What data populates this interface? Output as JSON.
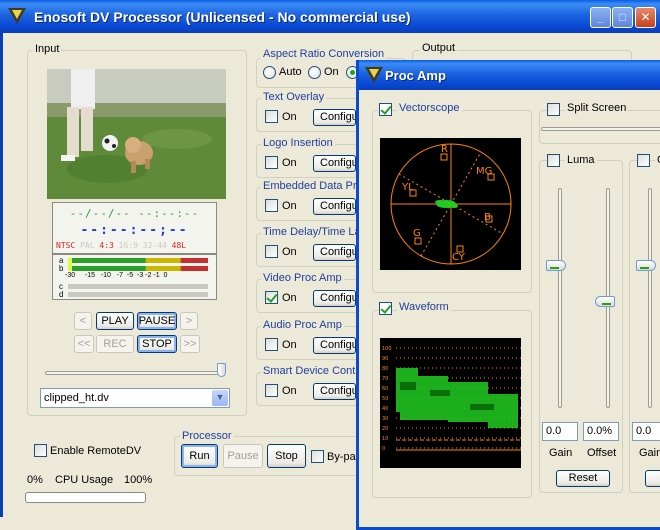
{
  "window": {
    "title": "Enosoft DV Processor (Unlicensed - No commercial use)",
    "minimize": "_",
    "maximize": "□",
    "close": "✕"
  },
  "input": {
    "label": "Input",
    "timecode_line1": "--/--/-- --:--:--",
    "timecode_line2": "--:--:--;--",
    "status_items": [
      "NTSC",
      "PAL",
      "4:3",
      "16:9",
      "32-44",
      "48L"
    ],
    "meter_rows": [
      "a",
      "b",
      "c",
      "d"
    ],
    "meter_scale": [
      "-30",
      "-15",
      "-10",
      "-7",
      "-5",
      "-3",
      "-2",
      "-1",
      "0"
    ],
    "buttons": {
      "prev": "<",
      "play": "PLAY",
      "pause": "PAUSE",
      "next": ">",
      "rewind": "<<",
      "rec": "REC",
      "stop": "STOP",
      "ffwd": ">>"
    },
    "file_select": "clipped_ht.dv"
  },
  "enable_remote": "Enable RemoteDV",
  "cpu": {
    "low": "0%",
    "label": "CPU Usage",
    "high": "100%",
    "usage": 0
  },
  "processor": {
    "label": "Processor",
    "run": "Run",
    "pause": "Pause",
    "stop": "Stop",
    "bypass": "By-pa"
  },
  "sections": [
    {
      "title": "Aspect Ratio Conversion"
    },
    {
      "title": "Text Overlay",
      "check": "On",
      "checked": false,
      "button": "Configu"
    },
    {
      "title": "Logo Insertion",
      "check": "On",
      "checked": false,
      "button": "Configu"
    },
    {
      "title": "Embedded Data Pro",
      "check": "On",
      "checked": false,
      "button": "Configu"
    },
    {
      "title": "Time Delay/Time La",
      "check": "On",
      "checked": false,
      "button": "Configu"
    },
    {
      "title": "Video Proc Amp",
      "check": "On",
      "checked": true,
      "button": "Configu"
    },
    {
      "title": "Audio Proc Amp",
      "check": "On",
      "checked": false,
      "button": "Configu"
    },
    {
      "title": "Smart Device Contr",
      "check": "On",
      "checked": false,
      "button": "Configu"
    }
  ],
  "aspect_radios": {
    "auto": "Auto",
    "on": "On",
    "selected": "third"
  },
  "output": {
    "label": "Output"
  },
  "proc_amp": {
    "title": "Proc Amp",
    "vectorscope": {
      "label": "Vectorscope",
      "checked": true,
      "targets": [
        "R",
        "MG",
        "YL",
        "B",
        "G",
        "CY"
      ]
    },
    "waveform": {
      "label": "Waveform",
      "checked": true,
      "scale": [
        "100",
        "90",
        "80",
        "70",
        "60",
        "50",
        "40",
        "30",
        "20",
        "10",
        "0"
      ]
    },
    "split_screen": {
      "label": "Split Screen",
      "checked": false
    },
    "luma": {
      "label": "Luma",
      "checked": false,
      "gain_value": "0.0",
      "offset_value": "0.0%",
      "gain_label": "Gain",
      "offset_label": "Offset",
      "reset": "Reset"
    },
    "chroma": {
      "label": "C",
      "checked": false,
      "gain_value": "0.0",
      "gain_label": "Gain"
    }
  },
  "colors": {
    "title_blue": "#0a4bd0",
    "scope_orange": "#ff8800",
    "trace_green": "#22cc22"
  }
}
